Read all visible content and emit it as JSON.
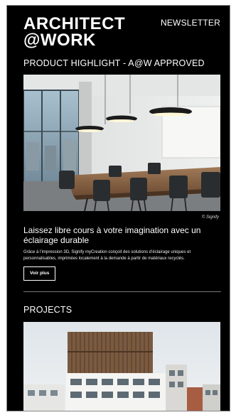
{
  "header": {
    "brand_line1": "ARCHITECT",
    "brand_line2": "@WORK",
    "newsletter_link": "NEWSLETTER"
  },
  "highlight": {
    "section_title": "PRODUCT HIGHLIGHT - A@W APPROVED",
    "image_credit": "© Signify",
    "headline": "Laissez libre cours à votre imagination avec un éclairage durable",
    "description": "Grâce à l’impression 3D, Signify myCreation conçoit des solutions d’éclairage uniques et personnalisables, imprimées localement à la demande à partir de matériaux recyclés.",
    "button_label": "Voir plus"
  },
  "projects": {
    "section_title": "PROJECTS"
  },
  "colors": {
    "background": "#000000",
    "text": "#ffffff",
    "divider": "#777777"
  }
}
